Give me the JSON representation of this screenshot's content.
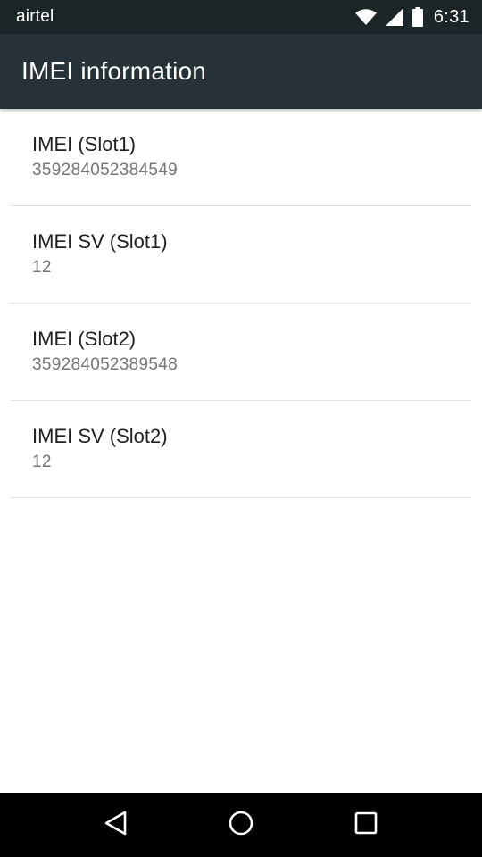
{
  "status_bar": {
    "carrier": "airtel",
    "time": "6:31",
    "icons": [
      "wifi-icon",
      "signal-icon",
      "battery-icon"
    ]
  },
  "app_bar": {
    "title": "IMEI information"
  },
  "items": [
    {
      "title": "IMEI (Slot1)",
      "summary": "359284052384549"
    },
    {
      "title": "IMEI SV (Slot1)",
      "summary": "12"
    },
    {
      "title": "IMEI (Slot2)",
      "summary": "359284052389548"
    },
    {
      "title": "IMEI SV (Slot2)",
      "summary": "12"
    }
  ],
  "nav_bar": {
    "buttons": [
      "back-icon",
      "home-icon",
      "recents-icon"
    ]
  },
  "colors": {
    "status_bar": "#1c2628",
    "app_bar": "#263238",
    "primary_text": "#212121",
    "secondary_text": "#757575",
    "divider": "#e3e3e3"
  }
}
